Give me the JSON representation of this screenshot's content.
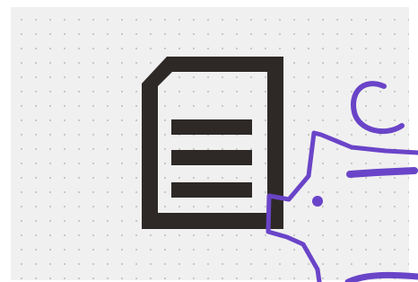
{
  "colors": {
    "background": "#ffffff",
    "panel": "#f0f0f0",
    "grid_dot": "#bdbdbd",
    "document_outline": "#2e2927",
    "accent": "#6a44c8"
  },
  "illustration": {
    "primary_icon": "document-icon",
    "secondary_icon": "piggy-bank-icon",
    "text_lines": 3
  }
}
